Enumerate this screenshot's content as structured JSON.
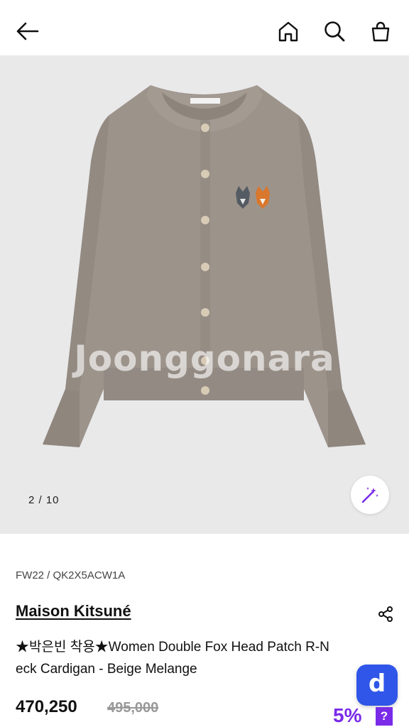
{
  "header": {
    "back_icon": "arrow-left-icon",
    "home_icon": "home-icon",
    "search_icon": "search-icon",
    "bag_icon": "shopping-bag-icon"
  },
  "gallery": {
    "watermark": "Joonggonara",
    "page_indicator": "2 / 10",
    "magic_icon": "magic-wand-icon",
    "background_color": "#e9e9ea",
    "product_color": "#9c938b"
  },
  "product": {
    "season_code": "FW22 / QK2X5ACW1A",
    "brand": "Maison Kitsuné",
    "title": "★박은빈 착용★Women Double Fox Head Patch R-Neck Cardigan - Beige Melange",
    "price": "470,250",
    "original_price": "495,000",
    "discount": "5%",
    "help_badge": "?",
    "share_icon": "share-icon"
  },
  "app_badge": {
    "letter": "d",
    "color": "#2f56e8"
  },
  "colors": {
    "discount": "#7a2be8"
  }
}
